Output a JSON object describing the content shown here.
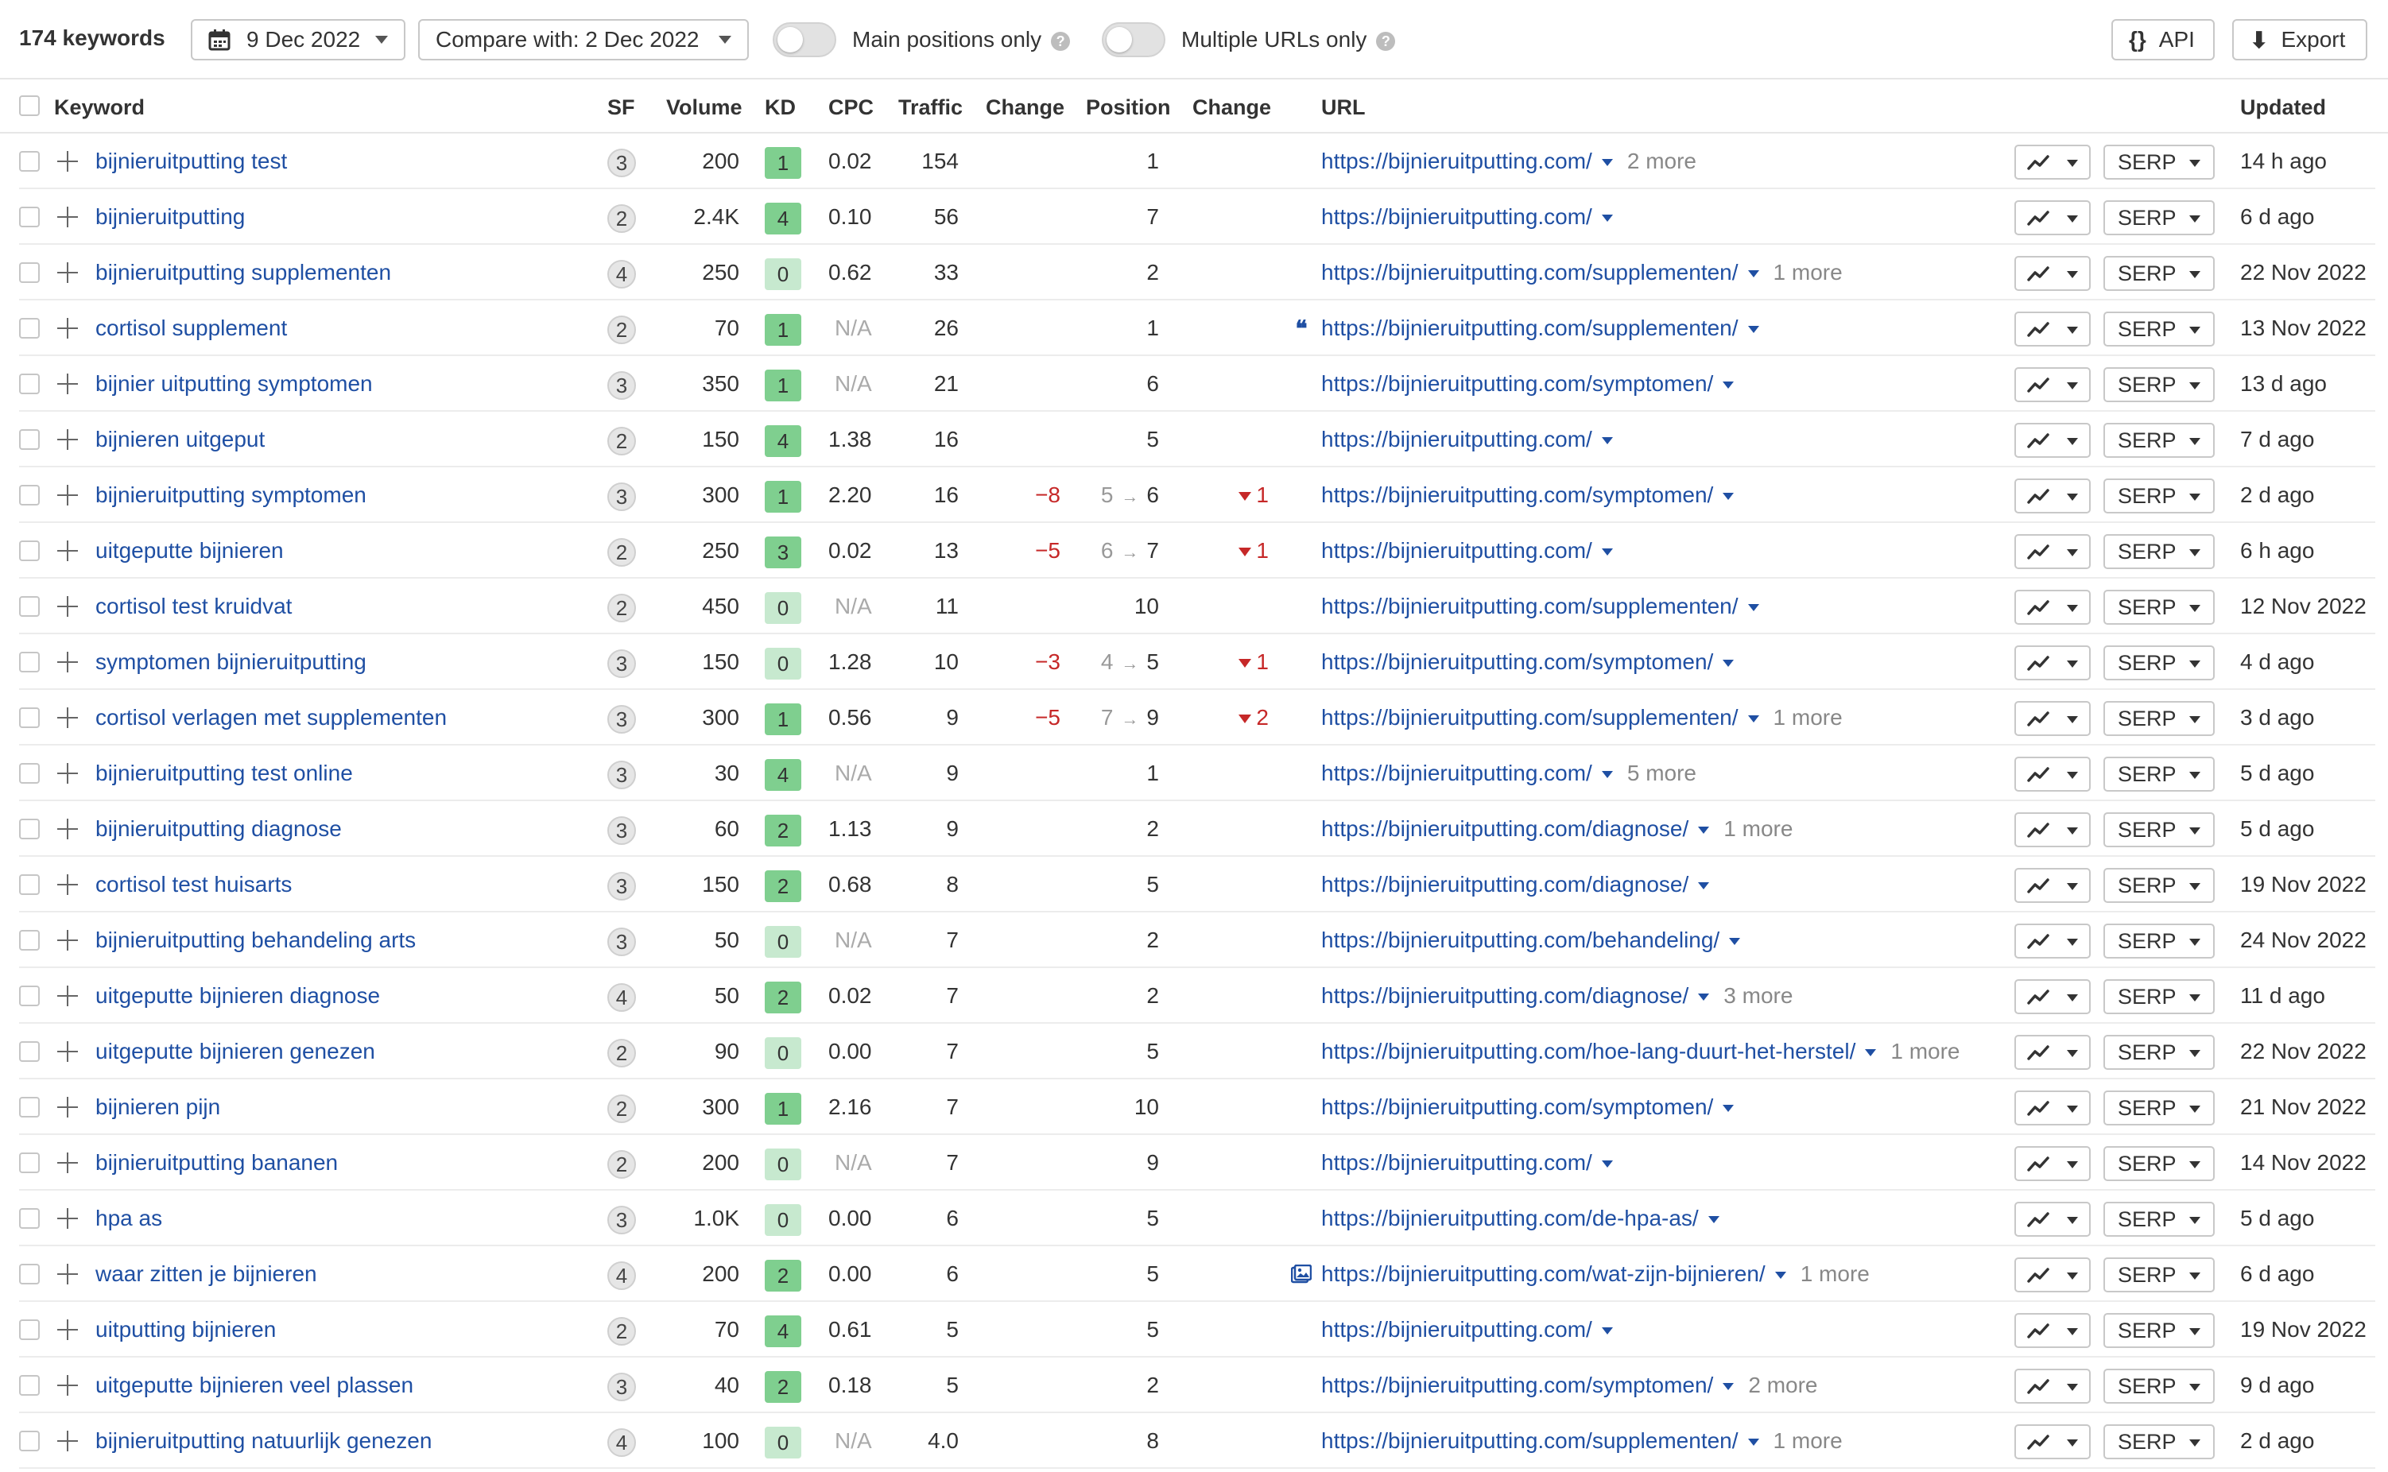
{
  "toolbar": {
    "keyword_count": "174 keywords",
    "date": "9 Dec 2022",
    "compare": "Compare with: 2 Dec 2022",
    "main_positions_label": "Main positions only",
    "multiple_urls_label": "Multiple URLs only",
    "help_glyph": "?",
    "api_label": "API",
    "api_icon_glyph": "{}",
    "export_label": "Export",
    "export_icon_glyph": "⬇",
    "icons": [
      "calendar-icon",
      "chevron-down-icon",
      "help-icon",
      "braces-icon",
      "download-icon"
    ]
  },
  "columns": {
    "keyword": "Keyword",
    "sf": "SF",
    "volume": "Volume",
    "kd": "KD",
    "cpc": "CPC",
    "traffic": "Traffic",
    "change": "Change",
    "position": "Position",
    "position_change": "Change",
    "url": "URL",
    "updated": "Updated"
  },
  "colors": {
    "link": "#1f4fa3",
    "negative": "#c62828",
    "kd_green_dark": "#7fcf8f",
    "kd_green_light": "#c7e9cf"
  },
  "rows": [
    {
      "keyword": "bijnieruitputting test",
      "sf": "3",
      "volume": "200",
      "kd": "1",
      "cpc": "0.02",
      "traffic": "154",
      "change": "",
      "pos_old": "",
      "pos": "1",
      "pchange": "",
      "feature": "",
      "url": "https://bijnieruitputting.com/",
      "more": "2 more",
      "trend": "trend-icon",
      "serp": "SERP",
      "updated": "14 h ago"
    },
    {
      "keyword": "bijnieruitputting",
      "sf": "2",
      "volume": "2.4K",
      "kd": "4",
      "cpc": "0.10",
      "traffic": "56",
      "change": "",
      "pos_old": "",
      "pos": "7",
      "pchange": "",
      "feature": "",
      "url": "https://bijnieruitputting.com/",
      "more": "",
      "trend": "trend-icon",
      "serp": "SERP",
      "updated": "6 d ago"
    },
    {
      "keyword": "bijnieruitputting supplementen",
      "sf": "4",
      "volume": "250",
      "kd": "0",
      "cpc": "0.62",
      "traffic": "33",
      "change": "",
      "pos_old": "",
      "pos": "2",
      "pchange": "",
      "feature": "",
      "url": "https://bijnieruitputting.com/supplementen/",
      "more": "1 more",
      "trend": "trend-icon",
      "serp": "SERP",
      "updated": "22 Nov 2022"
    },
    {
      "keyword": "cortisol supplement",
      "sf": "2",
      "volume": "70",
      "kd": "1",
      "cpc": "N/A",
      "traffic": "26",
      "change": "",
      "pos_old": "",
      "pos": "1",
      "pchange": "",
      "feature": "quote",
      "url": "https://bijnieruitputting.com/supplementen/",
      "more": "",
      "trend": "trend-icon",
      "serp": "SERP",
      "updated": "13 Nov 2022"
    },
    {
      "keyword": "bijnier uitputting symptomen",
      "sf": "3",
      "volume": "350",
      "kd": "1",
      "cpc": "N/A",
      "traffic": "21",
      "change": "",
      "pos_old": "",
      "pos": "6",
      "pchange": "",
      "feature": "",
      "url": "https://bijnieruitputting.com/symptomen/",
      "more": "",
      "trend": "trend-icon",
      "serp": "SERP",
      "updated": "13 d ago"
    },
    {
      "keyword": "bijnieren uitgeput",
      "sf": "2",
      "volume": "150",
      "kd": "4",
      "cpc": "1.38",
      "traffic": "16",
      "change": "",
      "pos_old": "",
      "pos": "5",
      "pchange": "",
      "feature": "",
      "url": "https://bijnieruitputting.com/",
      "more": "",
      "trend": "trend-icon",
      "serp": "SERP",
      "updated": "7 d ago"
    },
    {
      "keyword": "bijnieruitputting symptomen",
      "sf": "3",
      "volume": "300",
      "kd": "1",
      "cpc": "2.20",
      "traffic": "16",
      "change": "−8",
      "pos_old": "5",
      "pos": "6",
      "pchange": "1",
      "feature": "",
      "url": "https://bijnieruitputting.com/symptomen/",
      "more": "",
      "trend": "trend-icon",
      "serp": "SERP",
      "updated": "2 d ago"
    },
    {
      "keyword": "uitgeputte bijnieren",
      "sf": "2",
      "volume": "250",
      "kd": "3",
      "cpc": "0.02",
      "traffic": "13",
      "change": "−5",
      "pos_old": "6",
      "pos": "7",
      "pchange": "1",
      "feature": "",
      "url": "https://bijnieruitputting.com/",
      "more": "",
      "trend": "trend-icon",
      "serp": "SERP",
      "updated": "6 h ago"
    },
    {
      "keyword": "cortisol test kruidvat",
      "sf": "2",
      "volume": "450",
      "kd": "0",
      "cpc": "N/A",
      "traffic": "11",
      "change": "",
      "pos_old": "",
      "pos": "10",
      "pchange": "",
      "feature": "",
      "url": "https://bijnieruitputting.com/supplementen/",
      "more": "",
      "trend": "trend-icon",
      "serp": "SERP",
      "updated": "12 Nov 2022"
    },
    {
      "keyword": "symptomen bijnieruitputting",
      "sf": "3",
      "volume": "150",
      "kd": "0",
      "cpc": "1.28",
      "traffic": "10",
      "change": "−3",
      "pos_old": "4",
      "pos": "5",
      "pchange": "1",
      "feature": "",
      "url": "https://bijnieruitputting.com/symptomen/",
      "more": "",
      "trend": "trend-icon",
      "serp": "SERP",
      "updated": "4 d ago"
    },
    {
      "keyword": "cortisol verlagen met supplementen",
      "sf": "3",
      "volume": "300",
      "kd": "1",
      "cpc": "0.56",
      "traffic": "9",
      "change": "−5",
      "pos_old": "7",
      "pos": "9",
      "pchange": "2",
      "feature": "",
      "url": "https://bijnieruitputting.com/supplementen/",
      "more": "1 more",
      "trend": "trend-icon",
      "serp": "SERP",
      "updated": "3 d ago"
    },
    {
      "keyword": "bijnieruitputting test online",
      "sf": "3",
      "volume": "30",
      "kd": "4",
      "cpc": "N/A",
      "traffic": "9",
      "change": "",
      "pos_old": "",
      "pos": "1",
      "pchange": "",
      "feature": "",
      "url": "https://bijnieruitputting.com/",
      "more": "5 more",
      "trend": "trend-icon",
      "serp": "SERP",
      "updated": "5 d ago"
    },
    {
      "keyword": "bijnieruitputting diagnose",
      "sf": "3",
      "volume": "60",
      "kd": "2",
      "cpc": "1.13",
      "traffic": "9",
      "change": "",
      "pos_old": "",
      "pos": "2",
      "pchange": "",
      "feature": "",
      "url": "https://bijnieruitputting.com/diagnose/",
      "more": "1 more",
      "trend": "trend-icon",
      "serp": "SERP",
      "updated": "5 d ago"
    },
    {
      "keyword": "cortisol test huisarts",
      "sf": "3",
      "volume": "150",
      "kd": "2",
      "cpc": "0.68",
      "traffic": "8",
      "change": "",
      "pos_old": "",
      "pos": "5",
      "pchange": "",
      "feature": "",
      "url": "https://bijnieruitputting.com/diagnose/",
      "more": "",
      "trend": "trend-icon",
      "serp": "SERP",
      "updated": "19 Nov 2022"
    },
    {
      "keyword": "bijnieruitputting behandeling arts",
      "sf": "3",
      "volume": "50",
      "kd": "0",
      "cpc": "N/A",
      "traffic": "7",
      "change": "",
      "pos_old": "",
      "pos": "2",
      "pchange": "",
      "feature": "",
      "url": "https://bijnieruitputting.com/behandeling/",
      "more": "",
      "trend": "trend-icon",
      "serp": "SERP",
      "updated": "24 Nov 2022"
    },
    {
      "keyword": "uitgeputte bijnieren diagnose",
      "sf": "4",
      "volume": "50",
      "kd": "2",
      "cpc": "0.02",
      "traffic": "7",
      "change": "",
      "pos_old": "",
      "pos": "2",
      "pchange": "",
      "feature": "",
      "url": "https://bijnieruitputting.com/diagnose/",
      "more": "3 more",
      "trend": "trend-icon",
      "serp": "SERP",
      "updated": "11 d ago"
    },
    {
      "keyword": "uitgeputte bijnieren genezen",
      "sf": "2",
      "volume": "90",
      "kd": "0",
      "cpc": "0.00",
      "traffic": "7",
      "change": "",
      "pos_old": "",
      "pos": "5",
      "pchange": "",
      "feature": "",
      "url": "https://bijnieruitputting.com/hoe-lang-duurt-het-herstel/",
      "more": "1 more",
      "trend": "trend-icon",
      "serp": "SERP",
      "updated": "22 Nov 2022"
    },
    {
      "keyword": "bijnieren pijn",
      "sf": "2",
      "volume": "300",
      "kd": "1",
      "cpc": "2.16",
      "traffic": "7",
      "change": "",
      "pos_old": "",
      "pos": "10",
      "pchange": "",
      "feature": "",
      "url": "https://bijnieruitputting.com/symptomen/",
      "more": "",
      "trend": "trend-icon",
      "serp": "SERP",
      "updated": "21 Nov 2022"
    },
    {
      "keyword": "bijnieruitputting bananen",
      "sf": "2",
      "volume": "200",
      "kd": "0",
      "cpc": "N/A",
      "traffic": "7",
      "change": "",
      "pos_old": "",
      "pos": "9",
      "pchange": "",
      "feature": "",
      "url": "https://bijnieruitputting.com/",
      "more": "",
      "trend": "trend-icon",
      "serp": "SERP",
      "updated": "14 Nov 2022"
    },
    {
      "keyword": "hpa as",
      "sf": "3",
      "volume": "1.0K",
      "kd": "0",
      "cpc": "0.00",
      "traffic": "6",
      "change": "",
      "pos_old": "",
      "pos": "5",
      "pchange": "",
      "feature": "",
      "url": "https://bijnieruitputting.com/de-hpa-as/",
      "more": "",
      "trend": "trend-icon",
      "serp": "SERP",
      "updated": "5 d ago"
    },
    {
      "keyword": "waar zitten je bijnieren",
      "sf": "4",
      "volume": "200",
      "kd": "2",
      "cpc": "0.00",
      "traffic": "6",
      "change": "",
      "pos_old": "",
      "pos": "5",
      "pchange": "",
      "feature": "image",
      "url": "https://bijnieruitputting.com/wat-zijn-bijnieren/",
      "more": "1 more",
      "trend": "trend-icon",
      "serp": "SERP",
      "updated": "6 d ago"
    },
    {
      "keyword": "uitputting bijnieren",
      "sf": "2",
      "volume": "70",
      "kd": "4",
      "cpc": "0.61",
      "traffic": "5",
      "change": "",
      "pos_old": "",
      "pos": "5",
      "pchange": "",
      "feature": "",
      "url": "https://bijnieruitputting.com/",
      "more": "",
      "trend": "trend-icon",
      "serp": "SERP",
      "updated": "19 Nov 2022"
    },
    {
      "keyword": "uitgeputte bijnieren veel plassen",
      "sf": "3",
      "volume": "40",
      "kd": "2",
      "cpc": "0.18",
      "traffic": "5",
      "change": "",
      "pos_old": "",
      "pos": "2",
      "pchange": "",
      "feature": "",
      "url": "https://bijnieruitputting.com/symptomen/",
      "more": "2 more",
      "trend": "trend-icon",
      "serp": "SERP",
      "updated": "9 d ago"
    },
    {
      "keyword": "bijnieruitputting natuurlijk genezen",
      "sf": "4",
      "volume": "100",
      "kd": "0",
      "cpc": "N/A",
      "traffic": "4.0",
      "change": "",
      "pos_old": "",
      "pos": "8",
      "pchange": "",
      "feature": "",
      "url": "https://bijnieruitputting.com/supplementen/",
      "more": "1 more",
      "trend": "trend-icon",
      "serp": "SERP",
      "updated": "2 d ago"
    }
  ]
}
